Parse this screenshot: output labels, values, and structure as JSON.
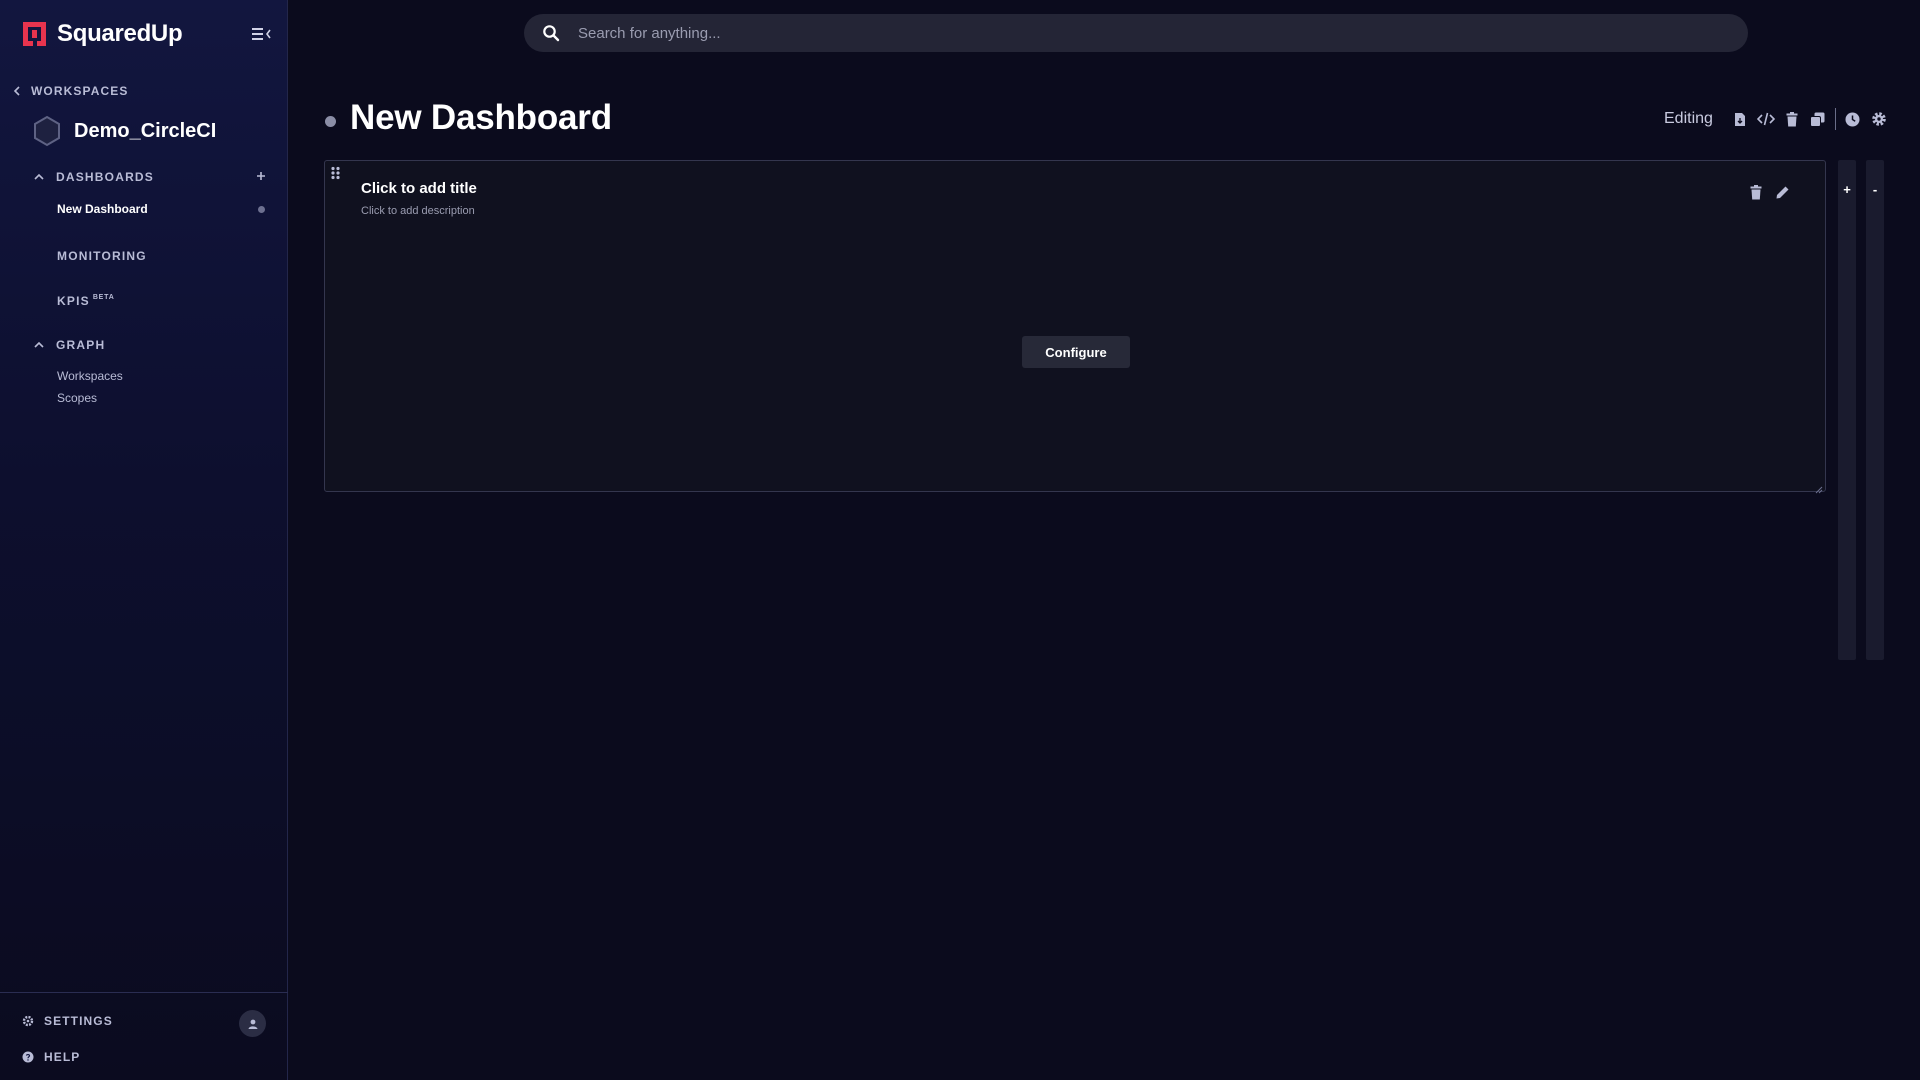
{
  "app": {
    "name": "SquaredUp",
    "brand_color": "#e8344e"
  },
  "search": {
    "placeholder": "Search for anything..."
  },
  "sidebar": {
    "back_label": "WORKSPACES",
    "workspace_name": "Demo_CircleCI",
    "sections": {
      "dashboards": {
        "label": "DASHBOARDS",
        "items": [
          {
            "label": "New Dashboard",
            "active": true
          }
        ]
      },
      "monitoring": {
        "label": "MONITORING"
      },
      "kpis": {
        "label": "KPIS",
        "badge": "BETA"
      },
      "graph": {
        "label": "GRAPH",
        "items": [
          {
            "label": "Workspaces"
          },
          {
            "label": "Scopes"
          }
        ]
      }
    },
    "bottom": {
      "settings_label": "SETTINGS",
      "help_label": "HELP"
    }
  },
  "dashboard": {
    "title": "New Dashboard",
    "mode_label": "Editing",
    "toolbar_icons": [
      "export-icon",
      "code-icon",
      "trash-icon",
      "copy-icon",
      "clock-icon",
      "gear-icon"
    ]
  },
  "tile": {
    "title_placeholder": "Click to add title",
    "description_placeholder": "Click to add description",
    "configure_label": "Configure"
  },
  "rails": {
    "add_label": "+",
    "remove_label": "-"
  }
}
